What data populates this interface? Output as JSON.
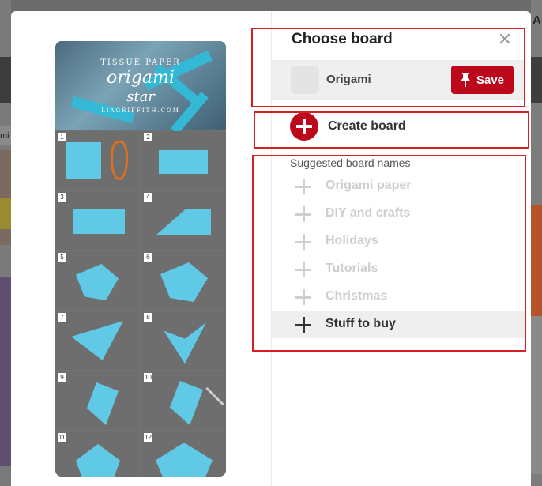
{
  "background": {
    "right_partial_text": "A",
    "left_partial_text": "mi"
  },
  "pin": {
    "header_line1": "TISSUE PAPER",
    "header_line2": "origami",
    "header_line3": "star",
    "header_line4": "LIAGRIFFITH.COM",
    "steps": [
      "1",
      "2",
      "3",
      "4",
      "5",
      "6",
      "7",
      "8",
      "9",
      "10",
      "11",
      "12"
    ]
  },
  "dialog": {
    "title": "Choose board",
    "close_icon": "close-icon",
    "current_board": {
      "name": "Origami",
      "save_label": "Save",
      "save_icon": "pushpin-icon"
    },
    "create_board_label": "Create board",
    "suggested_heading": "Suggested board names",
    "suggestions": [
      {
        "label": "Origami paper",
        "active": false
      },
      {
        "label": "DIY and crafts",
        "active": false
      },
      {
        "label": "Holidays",
        "active": false
      },
      {
        "label": "Tutorials",
        "active": false
      },
      {
        "label": "Christmas",
        "active": false
      },
      {
        "label": "Stuff to buy",
        "active": true
      }
    ]
  },
  "colors": {
    "brand_red": "#bd081c",
    "highlight_red": "#d81f26",
    "paper_blue": "#5fc9e6"
  }
}
